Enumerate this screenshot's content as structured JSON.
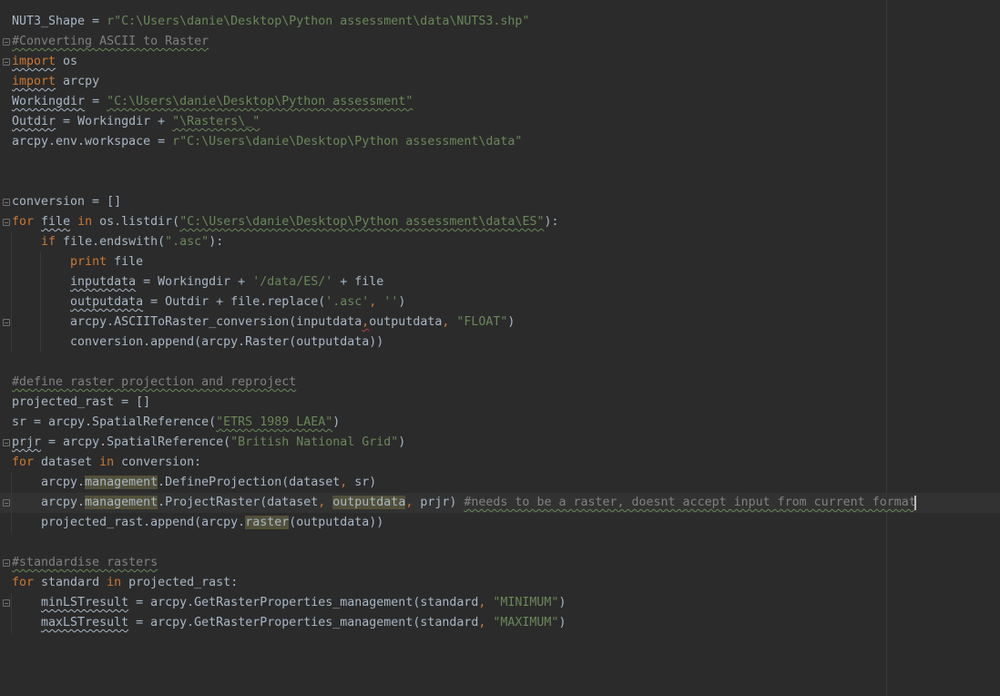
{
  "editor": {
    "colors": {
      "background": "#2b2b2b",
      "keyword": "#cc7832",
      "string": "#6a8759",
      "comment": "#808080",
      "text": "#a9b7c6",
      "usage_highlight": "#52503a"
    },
    "lines": [
      [
        {
          "t": "NUT3_Shape = "
        },
        {
          "t": "r\"C:\\Users\\danie\\Desktop\\Python assessment\\data\\NUTS3.shp\"",
          "c": "str"
        }
      ],
      [
        {
          "t": "#Converting ASCII to Raster",
          "c": "cm typo"
        }
      ],
      [
        {
          "t": "import",
          "c": "kw weak"
        },
        {
          "t": " os"
        }
      ],
      [
        {
          "t": "import",
          "c": "kw weak"
        },
        {
          "t": " arcpy"
        }
      ],
      [
        {
          "t": "Workingdir",
          "c": "weak"
        },
        {
          "t": " = "
        },
        {
          "t": "\"C:\\Users\\danie\\Desktop\\Python assessment\"",
          "c": "str typo"
        }
      ],
      [
        {
          "t": "Outdir",
          "c": "weak"
        },
        {
          "t": " = Workingdir + "
        },
        {
          "t": "\"\\Rasters\\_\"",
          "c": "str typo"
        }
      ],
      [
        {
          "t": "arcpy.env.workspace = "
        },
        {
          "t": "r\"C:\\Users\\danie\\Desktop\\Python assessment\\data\"",
          "c": "str"
        }
      ],
      [],
      [],
      [
        {
          "t": "conversion = []"
        }
      ],
      [
        {
          "t": "for",
          "c": "kw"
        },
        {
          "t": " "
        },
        {
          "t": "file",
          "c": "weak"
        },
        {
          "t": " "
        },
        {
          "t": "in",
          "c": "kw"
        },
        {
          "t": " os.listdir("
        },
        {
          "t": "\"C:\\Users\\danie\\Desktop\\Python assessment\\data\\ES\"",
          "c": "str typo"
        },
        {
          "t": "):"
        }
      ],
      [
        {
          "t": "    "
        },
        {
          "t": "if",
          "c": "kw"
        },
        {
          "t": " file.endswith("
        },
        {
          "t": "\".asc\"",
          "c": "str"
        },
        {
          "t": "):"
        }
      ],
      [
        {
          "t": "        "
        },
        {
          "t": "print",
          "c": "kw"
        },
        {
          "t": " file"
        }
      ],
      [
        {
          "t": "        "
        },
        {
          "t": "inputdata",
          "c": "weak"
        },
        {
          "t": " = Workingdir + "
        },
        {
          "t": "'/data/ES/'",
          "c": "str"
        },
        {
          "t": " + file"
        }
      ],
      [
        {
          "t": "        "
        },
        {
          "t": "outputdata",
          "c": "weak"
        },
        {
          "t": " = Outdir + file.replace("
        },
        {
          "t": "'.asc'",
          "c": "str"
        },
        {
          "t": ", ",
          "c": "kw"
        },
        {
          "t": "''",
          "c": "str"
        },
        {
          "t": ")"
        }
      ],
      [
        {
          "t": "        arcpy.ASCIIToRaster_conversion(inputdata"
        },
        {
          "t": ",",
          "c": "kw errline"
        },
        {
          "t": "outputdata"
        },
        {
          "t": ", ",
          "c": "kw"
        },
        {
          "t": "\"FLOAT\"",
          "c": "str"
        },
        {
          "t": ")"
        }
      ],
      [
        {
          "t": "        conversion.append(arcpy.Raster(outputdata))"
        }
      ],
      [],
      [
        {
          "t": "#define raster projection and reproject",
          "c": "cm typo"
        }
      ],
      [
        {
          "t": "projected_rast = []"
        }
      ],
      [
        {
          "t": "sr = arcpy.SpatialReference("
        },
        {
          "t": "\"ETRS 1989 LAEA\"",
          "c": "str typo"
        },
        {
          "t": ")"
        }
      ],
      [
        {
          "t": "prjr",
          "c": "weak"
        },
        {
          "t": " = arcpy.SpatialReference("
        },
        {
          "t": "\"British National Grid\"",
          "c": "str"
        },
        {
          "t": ")"
        }
      ],
      [
        {
          "t": "for",
          "c": "kw"
        },
        {
          "t": " dataset "
        },
        {
          "t": "in",
          "c": "kw"
        },
        {
          "t": " conversion:"
        }
      ],
      [
        {
          "t": "    arcpy."
        },
        {
          "t": "management",
          "c": "hl"
        },
        {
          "t": ".DefineProjection(dataset"
        },
        {
          "t": ", ",
          "c": "kw"
        },
        {
          "t": "sr)"
        }
      ],
      [
        {
          "t": "    arcpy."
        },
        {
          "t": "management",
          "c": "hl"
        },
        {
          "t": ".ProjectRaster(dataset"
        },
        {
          "t": ", ",
          "c": "kw"
        },
        {
          "t": "outputdata",
          "c": "hl"
        },
        {
          "t": ", ",
          "c": "kw"
        },
        {
          "t": "prjr) "
        },
        {
          "t": "#needs to be a raster, doesnt accept input from current format",
          "c": "cm typo"
        }
      ],
      [
        {
          "t": "    projected_rast.append(arcpy."
        },
        {
          "t": "raster",
          "c": "hl"
        },
        {
          "t": "(outputdata))"
        }
      ],
      [],
      [
        {
          "t": "#standardise rasters",
          "c": "cm typo"
        }
      ],
      [
        {
          "t": "for",
          "c": "kw"
        },
        {
          "t": " standard "
        },
        {
          "t": "in",
          "c": "kw"
        },
        {
          "t": " projected_rast:"
        }
      ],
      [
        {
          "t": "    "
        },
        {
          "t": "minLSTresult",
          "c": "weak"
        },
        {
          "t": " = arcpy.GetRasterProperties_management(standard"
        },
        {
          "t": ", ",
          "c": "kw"
        },
        {
          "t": "\"MINIMUM\"",
          "c": "str"
        },
        {
          "t": ")"
        }
      ],
      [
        {
          "t": "    "
        },
        {
          "t": "maxLSTresult",
          "c": "weak"
        },
        {
          "t": " = arcpy.GetRasterProperties_management(standard"
        },
        {
          "t": ", ",
          "c": "kw"
        },
        {
          "t": "\"MAXIMUM\"",
          "c": "str"
        },
        {
          "t": ")"
        }
      ]
    ],
    "current_line_index": 24,
    "fold_marker_lines": [
      2,
      3,
      10,
      11,
      16,
      22,
      25,
      28,
      30
    ]
  }
}
